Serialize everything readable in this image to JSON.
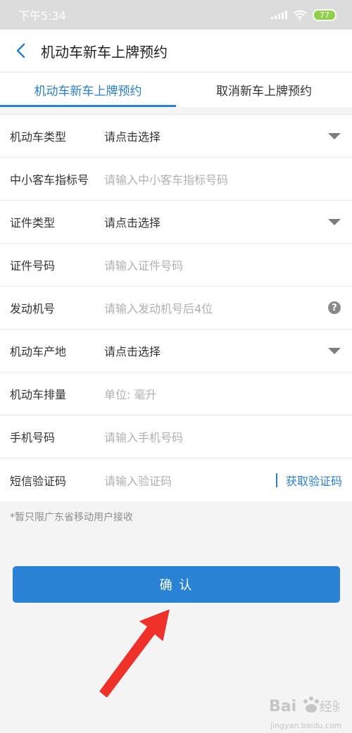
{
  "status_bar": {
    "time": "下午5:34",
    "battery": "77"
  },
  "header": {
    "title": "机动车新车上牌预约"
  },
  "tabs": [
    {
      "label": "机动车新车上牌预约",
      "active": true
    },
    {
      "label": "取消新车上牌预约",
      "active": false
    }
  ],
  "form": {
    "vehicle_type": {
      "label": "机动车类型",
      "value": "请点击选择"
    },
    "quota_number": {
      "label": "中小客车指标号",
      "placeholder": "请输入中小客车指标号码"
    },
    "id_type": {
      "label": "证件类型",
      "value": "请点击选择"
    },
    "id_number": {
      "label": "证件号码",
      "placeholder": "请输入证件号码"
    },
    "engine_number": {
      "label": "发动机号",
      "placeholder": "请输入发动机号后4位"
    },
    "origin": {
      "label": "机动车产地",
      "value": "请点击选择"
    },
    "displacement": {
      "label": "机动车排量",
      "placeholder": "单位: 毫升"
    },
    "phone": {
      "label": "手机号码",
      "placeholder": "请输入手机号码"
    },
    "sms_code": {
      "label": "短信验证码",
      "placeholder": "请输入验证码",
      "button": "获取验证码"
    }
  },
  "note": "*暂只限广东省移动用户接收",
  "confirm_label": "确 认",
  "watermark": {
    "text": "jingyan.baidu.com"
  },
  "colors": {
    "accent": "#2a7fcf",
    "button": "#2a82d5",
    "arrow": "#f0312a"
  }
}
